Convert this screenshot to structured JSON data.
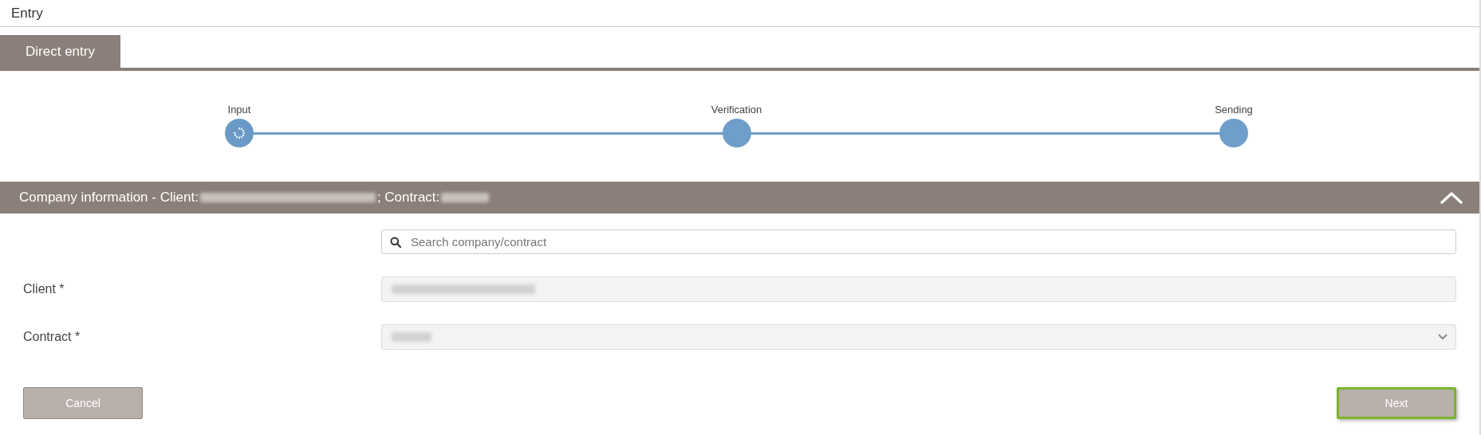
{
  "page_title": "Entry",
  "tabs": [
    {
      "label": "Direct entry",
      "selected": true
    }
  ],
  "steps": [
    {
      "label": "Input",
      "active": true
    },
    {
      "label": "Verification",
      "active": false
    },
    {
      "label": "Sending",
      "active": false
    }
  ],
  "section": {
    "title_prefix": "Company information - Client:",
    "contract_label": "; Contract:",
    "expanded": true
  },
  "search": {
    "placeholder": "Search company/contract"
  },
  "fields": [
    {
      "label": "Client *",
      "kind": "text",
      "disabled": true
    },
    {
      "label": "Contract *",
      "kind": "select",
      "disabled": true
    }
  ],
  "buttons": [
    {
      "label": "Cancel",
      "focused": false
    },
    {
      "label": "Next",
      "focused": true
    }
  ]
}
